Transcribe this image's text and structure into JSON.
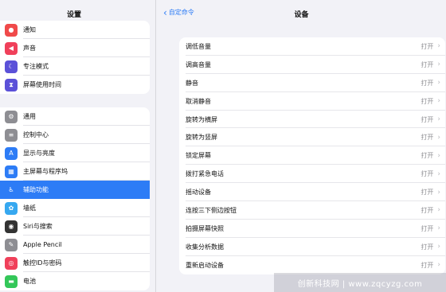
{
  "sidebar": {
    "title": "设置",
    "group1": [
      {
        "label": "通知",
        "icon": "bell-icon",
        "color": "#f04a4a",
        "glyph": "●"
      },
      {
        "label": "声音",
        "icon": "speaker-icon",
        "color": "#f0405a",
        "glyph": "◀"
      },
      {
        "label": "专注模式",
        "icon": "moon-icon",
        "color": "#5b51d8",
        "glyph": "☾"
      },
      {
        "label": "屏幕使用时间",
        "icon": "hourglass-icon",
        "color": "#5b51d8",
        "glyph": "⧗"
      }
    ],
    "group2": [
      {
        "label": "通用",
        "icon": "gear-icon",
        "color": "#8e8e93",
        "glyph": "⚙"
      },
      {
        "label": "控制中心",
        "icon": "control-center-icon",
        "color": "#8e8e93",
        "glyph": "≡"
      },
      {
        "label": "显示与亮度",
        "icon": "display-icon",
        "color": "#2d7cf6",
        "glyph": "A"
      },
      {
        "label": "主屏幕与程序坞",
        "icon": "home-screen-icon",
        "color": "#2d7cf6",
        "glyph": "▦"
      },
      {
        "label": "辅助功能",
        "icon": "accessibility-icon",
        "color": "#2d7cf6",
        "glyph": "♿",
        "selected": true
      },
      {
        "label": "墙纸",
        "icon": "wallpaper-icon",
        "color": "#36a8f0",
        "glyph": "✿"
      },
      {
        "label": "Siri与搜索",
        "icon": "siri-icon",
        "color": "#333333",
        "glyph": "◉"
      },
      {
        "label": "Apple Pencil",
        "icon": "pencil-icon",
        "color": "#8e8e93",
        "glyph": "✎"
      },
      {
        "label": "触控ID与密码",
        "icon": "fingerprint-icon",
        "color": "#f0405a",
        "glyph": "◎"
      },
      {
        "label": "电池",
        "icon": "battery-icon",
        "color": "#34c759",
        "glyph": "▬"
      }
    ]
  },
  "detail": {
    "back_label": "自定命令",
    "title": "设备",
    "value_label": "打开",
    "rows": [
      "调低音量",
      "调高音量",
      "静音",
      "取消静音",
      "旋转为横屏",
      "旋转为竖屏",
      "锁定屏幕",
      "拨打紧急电话",
      "摇动设备",
      "连按三下侧边按钮",
      "拍摄屏幕快照",
      "收集分析数据",
      "重新启动设备"
    ]
  },
  "watermark": "创新科技网 | www.zqcyzg.com"
}
